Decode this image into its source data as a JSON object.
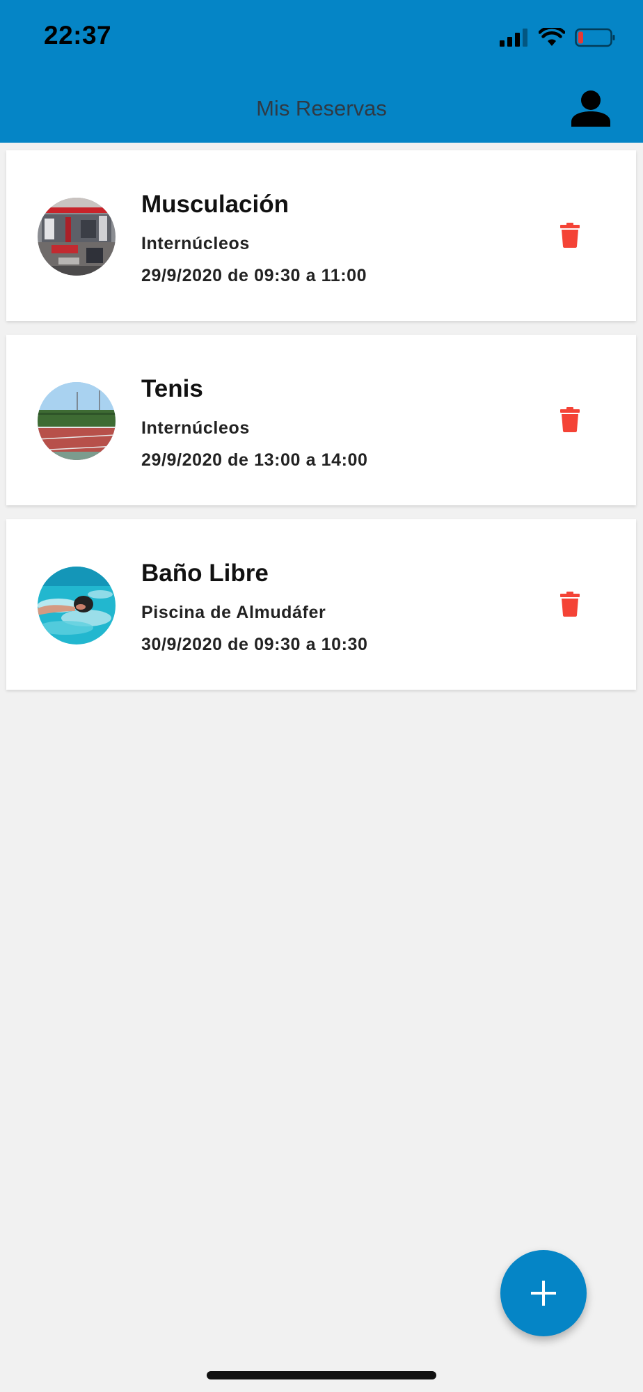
{
  "status_bar": {
    "time": "22:37"
  },
  "header": {
    "title": "Mis Reservas",
    "profile_icon": "person-icon"
  },
  "reservations": [
    {
      "title": "Musculación",
      "venue": "Internúcleos",
      "time": "29/9/2020 de 09:30 a 11:00",
      "image": "gym-photo"
    },
    {
      "title": "Tenis",
      "venue": "Internúcleos",
      "time": "29/9/2020 de 13:00 a 14:00",
      "image": "tennis-court-photo"
    },
    {
      "title": "Baño Libre",
      "venue": "Piscina de Almudáfer",
      "time": "30/9/2020 de 09:30 a 10:30",
      "image": "swimmer-photo"
    }
  ],
  "colors": {
    "primary": "#0585c6",
    "delete": "#f44336",
    "background": "#f1f1f1"
  },
  "fab": {
    "icon": "plus-icon"
  }
}
